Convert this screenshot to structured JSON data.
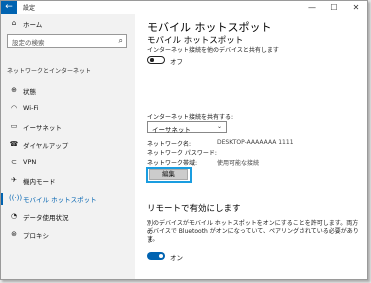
{
  "window": {
    "title": "設定",
    "controls": [
      "—",
      "☐",
      "✕"
    ]
  },
  "sidebar": {
    "home": "ホーム",
    "search_placeholder": "設定の検索",
    "section": "ネットワークとインターネット",
    "items": [
      {
        "label": "状態",
        "icon": "status-icon"
      },
      {
        "label": "Wi-Fi",
        "icon": "wifi-icon"
      },
      {
        "label": "イーサネット",
        "icon": "ethernet-icon"
      },
      {
        "label": "ダイヤルアップ",
        "icon": "dialup-icon"
      },
      {
        "label": "VPN",
        "icon": "vpn-icon"
      },
      {
        "label": "機内モード",
        "icon": "airplane-icon"
      },
      {
        "label": "モバイル ホットスポット",
        "icon": "hotspot-icon",
        "active": true
      },
      {
        "label": "データ使用状況",
        "icon": "data-usage-icon"
      },
      {
        "label": "プロキシ",
        "icon": "proxy-icon"
      }
    ]
  },
  "main": {
    "page_title": "モバイル ホットスポット",
    "heading": "モバイル ホットスポット",
    "description": "インターネット接続を他のデバイスと共有します",
    "toggle_label": "オフ",
    "share_label": "インターネット接続を共有する:",
    "share_value": "イーサネット",
    "network_name_label": "ネットワーク名:",
    "network_name_value": "DESKTOP-AAAAAAA 1111",
    "password_label": "ネットワーク パスワード:",
    "band_label": "ネットワーク帯域:",
    "band_value": "使用可能な接続",
    "edit_button": "編集",
    "remote_heading": "リモートで有効にします",
    "remote_para_1": "別のデバイスがモバイル ホットスポットをオンにすることを許可します。両方の",
    "remote_para_2": "デバイスで Bluetooth がオンになっていて、ペアリングされている必要がありま",
    "remote_para_3": "す。",
    "remote_toggle_label": "オン"
  },
  "colors": {
    "accent": "#0063b1",
    "highlight": "#1a9de0"
  }
}
